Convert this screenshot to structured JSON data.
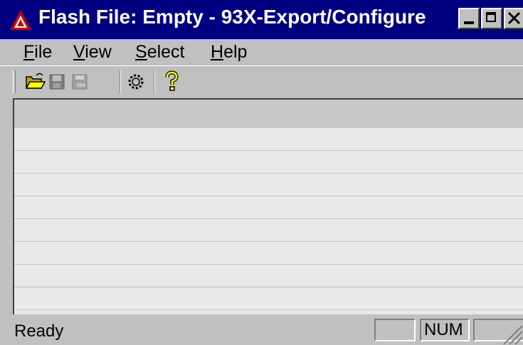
{
  "window": {
    "title": "Flash File: Empty - 93X-Export/Configure",
    "controls": [
      "minimize-icon",
      "maximize-icon",
      "close-icon"
    ]
  },
  "menu": {
    "items": [
      {
        "label_underlined": "F",
        "label_rest": "ile"
      },
      {
        "label_underlined": "V",
        "label_rest": "iew"
      },
      {
        "label_underlined": "S",
        "label_rest": "elect"
      },
      {
        "label_underlined": "H",
        "label_rest": "elp"
      }
    ]
  },
  "toolbar": {
    "buttons": [
      "open-folder-icon",
      "save-icon",
      "export-csv-icon",
      "settings-gear-icon",
      "help-icon"
    ]
  },
  "list": {
    "row_count": 8
  },
  "status": {
    "text": "Ready",
    "panel_1": "",
    "panel_num": "NUM",
    "panel_3": ""
  },
  "colors": {
    "titlebar": "#000080",
    "face": "#c0c0c0",
    "list_bg": "#e8e8e8",
    "list_header": "#c8c8c8",
    "help_icon": "#ffff00"
  }
}
